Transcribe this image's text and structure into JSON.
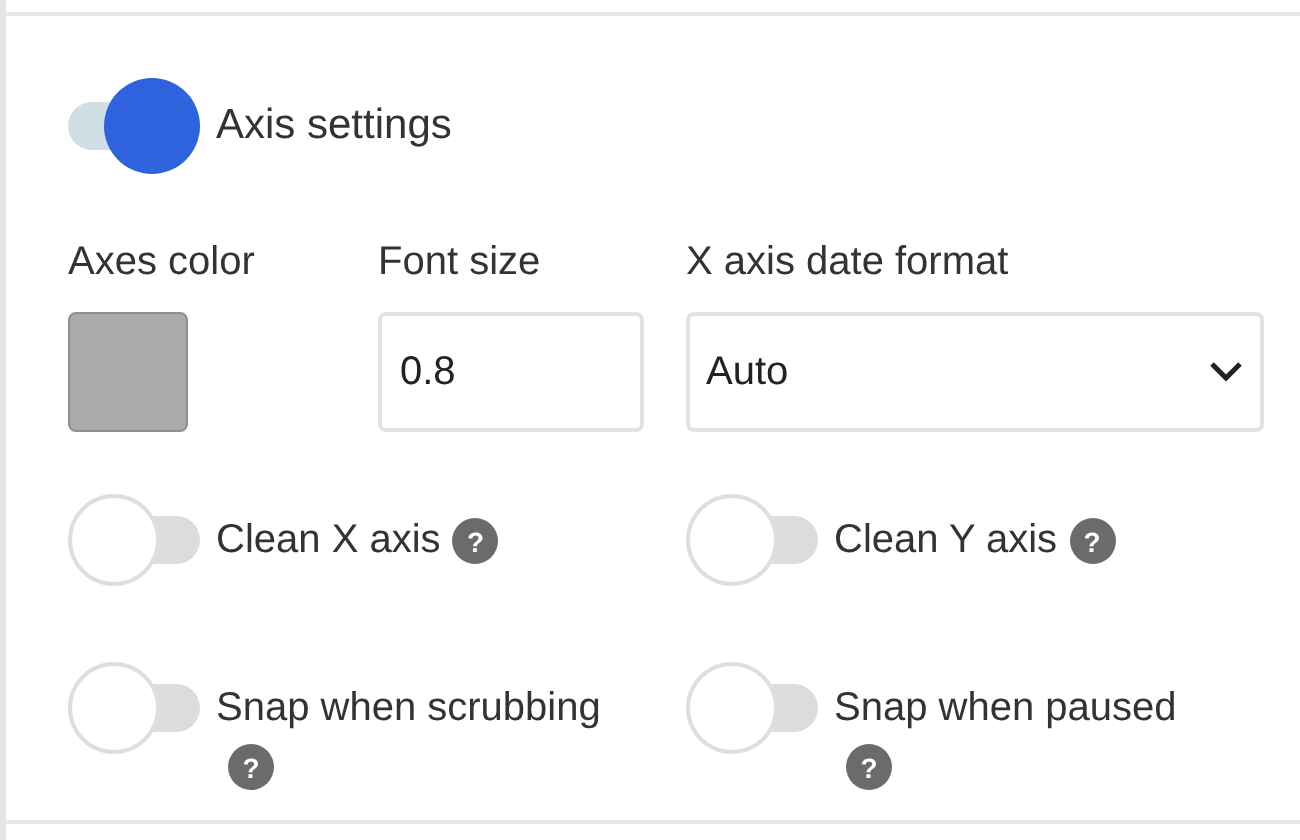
{
  "axis_settings": {
    "label": "Axis settings",
    "on": true
  },
  "axes_color": {
    "label": "Axes color",
    "color": "#aaaaaa"
  },
  "font_size": {
    "label": "Font size",
    "value": "0.8"
  },
  "date_format": {
    "label": "X axis date format",
    "value": "Auto"
  },
  "toggles": [
    {
      "label": "Clean X axis",
      "on": false,
      "help": "?"
    },
    {
      "label": "Clean Y axis",
      "on": false,
      "help": "?"
    },
    {
      "label": "Snap when scrubbing",
      "on": false,
      "help": "?"
    },
    {
      "label": "Snap when paused",
      "on": false,
      "help": "?"
    }
  ]
}
